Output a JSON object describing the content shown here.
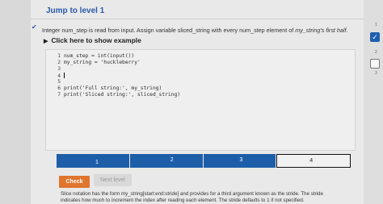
{
  "header": {
    "jump_label": "Jump to level 1"
  },
  "instructions": {
    "text_before": "Integer num_step is read from input. Assign variable sliced_string with every num_step element of ",
    "text_italic": "my_string's first half",
    "text_after": "."
  },
  "example": {
    "label": "Click here to show example"
  },
  "code": {
    "lines": [
      {
        "num": "1",
        "text": "num_step = int(input())"
      },
      {
        "num": "2",
        "text": "my_string = 'huckleberry'"
      },
      {
        "num": "3",
        "text": ""
      },
      {
        "num": "4",
        "text": ""
      },
      {
        "num": "5",
        "text": ""
      },
      {
        "num": "6",
        "text": "print('Full string:', my_string)"
      },
      {
        "num": "7",
        "text": "print('Sliced string:', sliced_string)"
      }
    ]
  },
  "levels": {
    "items": [
      "1",
      "2",
      "3",
      "4"
    ],
    "active_index": 3
  },
  "buttons": {
    "check_label": "Check",
    "next_label": "Next level"
  },
  "hint": {
    "line1": "Slice notation has the form my_string[start:end:stride] and provides for a third argument known as the stride. The stride",
    "line2": "indicates how much to increment the index after reading each element. The stride defaults to 1 if not specified."
  },
  "sidebar": {
    "labels": [
      "1",
      "2",
      "3"
    ]
  },
  "colors": {
    "accent": "#1d5ea8",
    "check": "#e0752e",
    "link": "#2a5aa8"
  }
}
